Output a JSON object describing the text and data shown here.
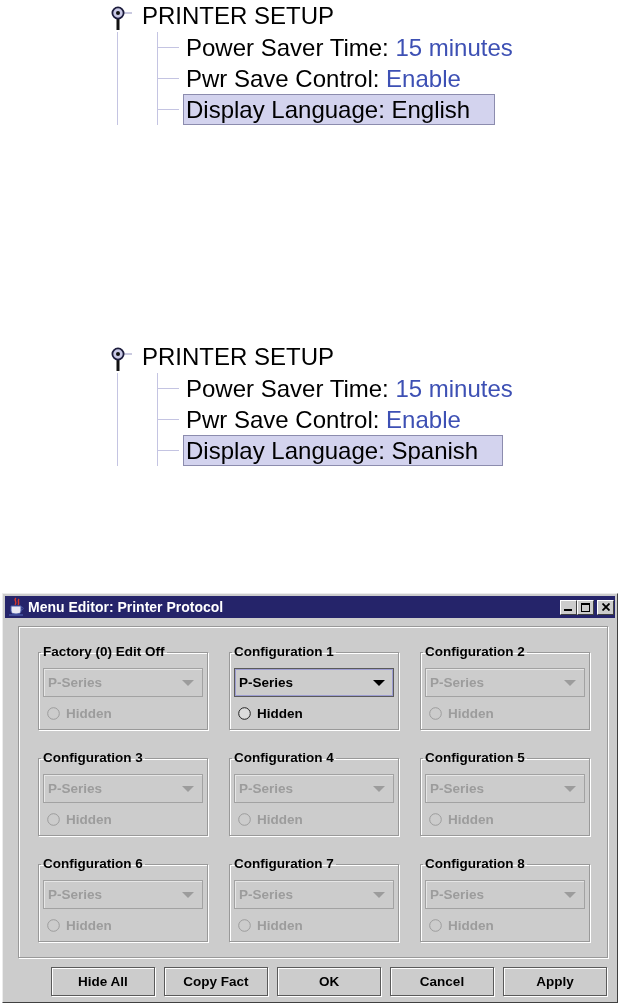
{
  "trees": [
    {
      "title": "PRINTER SETUP",
      "items": [
        {
          "label": "Power Saver Time:",
          "value": "15 minutes",
          "selected": false
        },
        {
          "label": "Pwr Save Control:",
          "value": "Enable",
          "selected": false
        },
        {
          "label": "Display Language:",
          "value": "English",
          "selected": true
        }
      ]
    },
    {
      "title": "PRINTER SETUP",
      "items": [
        {
          "label": "Power Saver Time:",
          "value": "15 minutes",
          "selected": false
        },
        {
          "label": "Pwr Save Control:",
          "value": "Enable",
          "selected": false
        },
        {
          "label": "Display Language:",
          "value": "Spanish",
          "selected": true
        }
      ]
    }
  ],
  "dialog": {
    "title": "Menu Editor: Printer Protocol",
    "groups": [
      {
        "title": "Factory (0) Edit Off",
        "enabled": false,
        "selection": "P-Series",
        "option": {
          "label": "Hidden",
          "checked": false
        }
      },
      {
        "title": "Configuration 1",
        "enabled": true,
        "selection": "P-Series",
        "option": {
          "label": "Hidden",
          "checked": false
        }
      },
      {
        "title": "Configuration 2",
        "enabled": false,
        "selection": "P-Series",
        "option": {
          "label": "Hidden",
          "checked": false
        }
      },
      {
        "title": "Configuration 3",
        "enabled": false,
        "selection": "P-Series",
        "option": {
          "label": "Hidden",
          "checked": false
        }
      },
      {
        "title": "Configuration 4",
        "enabled": false,
        "selection": "P-Series",
        "option": {
          "label": "Hidden",
          "checked": false
        }
      },
      {
        "title": "Configuration 5",
        "enabled": false,
        "selection": "P-Series",
        "option": {
          "label": "Hidden",
          "checked": false
        }
      },
      {
        "title": "Configuration 6",
        "enabled": false,
        "selection": "P-Series",
        "option": {
          "label": "Hidden",
          "checked": false
        }
      },
      {
        "title": "Configuration 7",
        "enabled": false,
        "selection": "P-Series",
        "option": {
          "label": "Hidden",
          "checked": false
        }
      },
      {
        "title": "Configuration 8",
        "enabled": false,
        "selection": "P-Series",
        "option": {
          "label": "Hidden",
          "checked": false
        }
      }
    ],
    "buttons": [
      "Hide All",
      "Copy Fact",
      "OK",
      "Cancel",
      "Apply"
    ]
  }
}
